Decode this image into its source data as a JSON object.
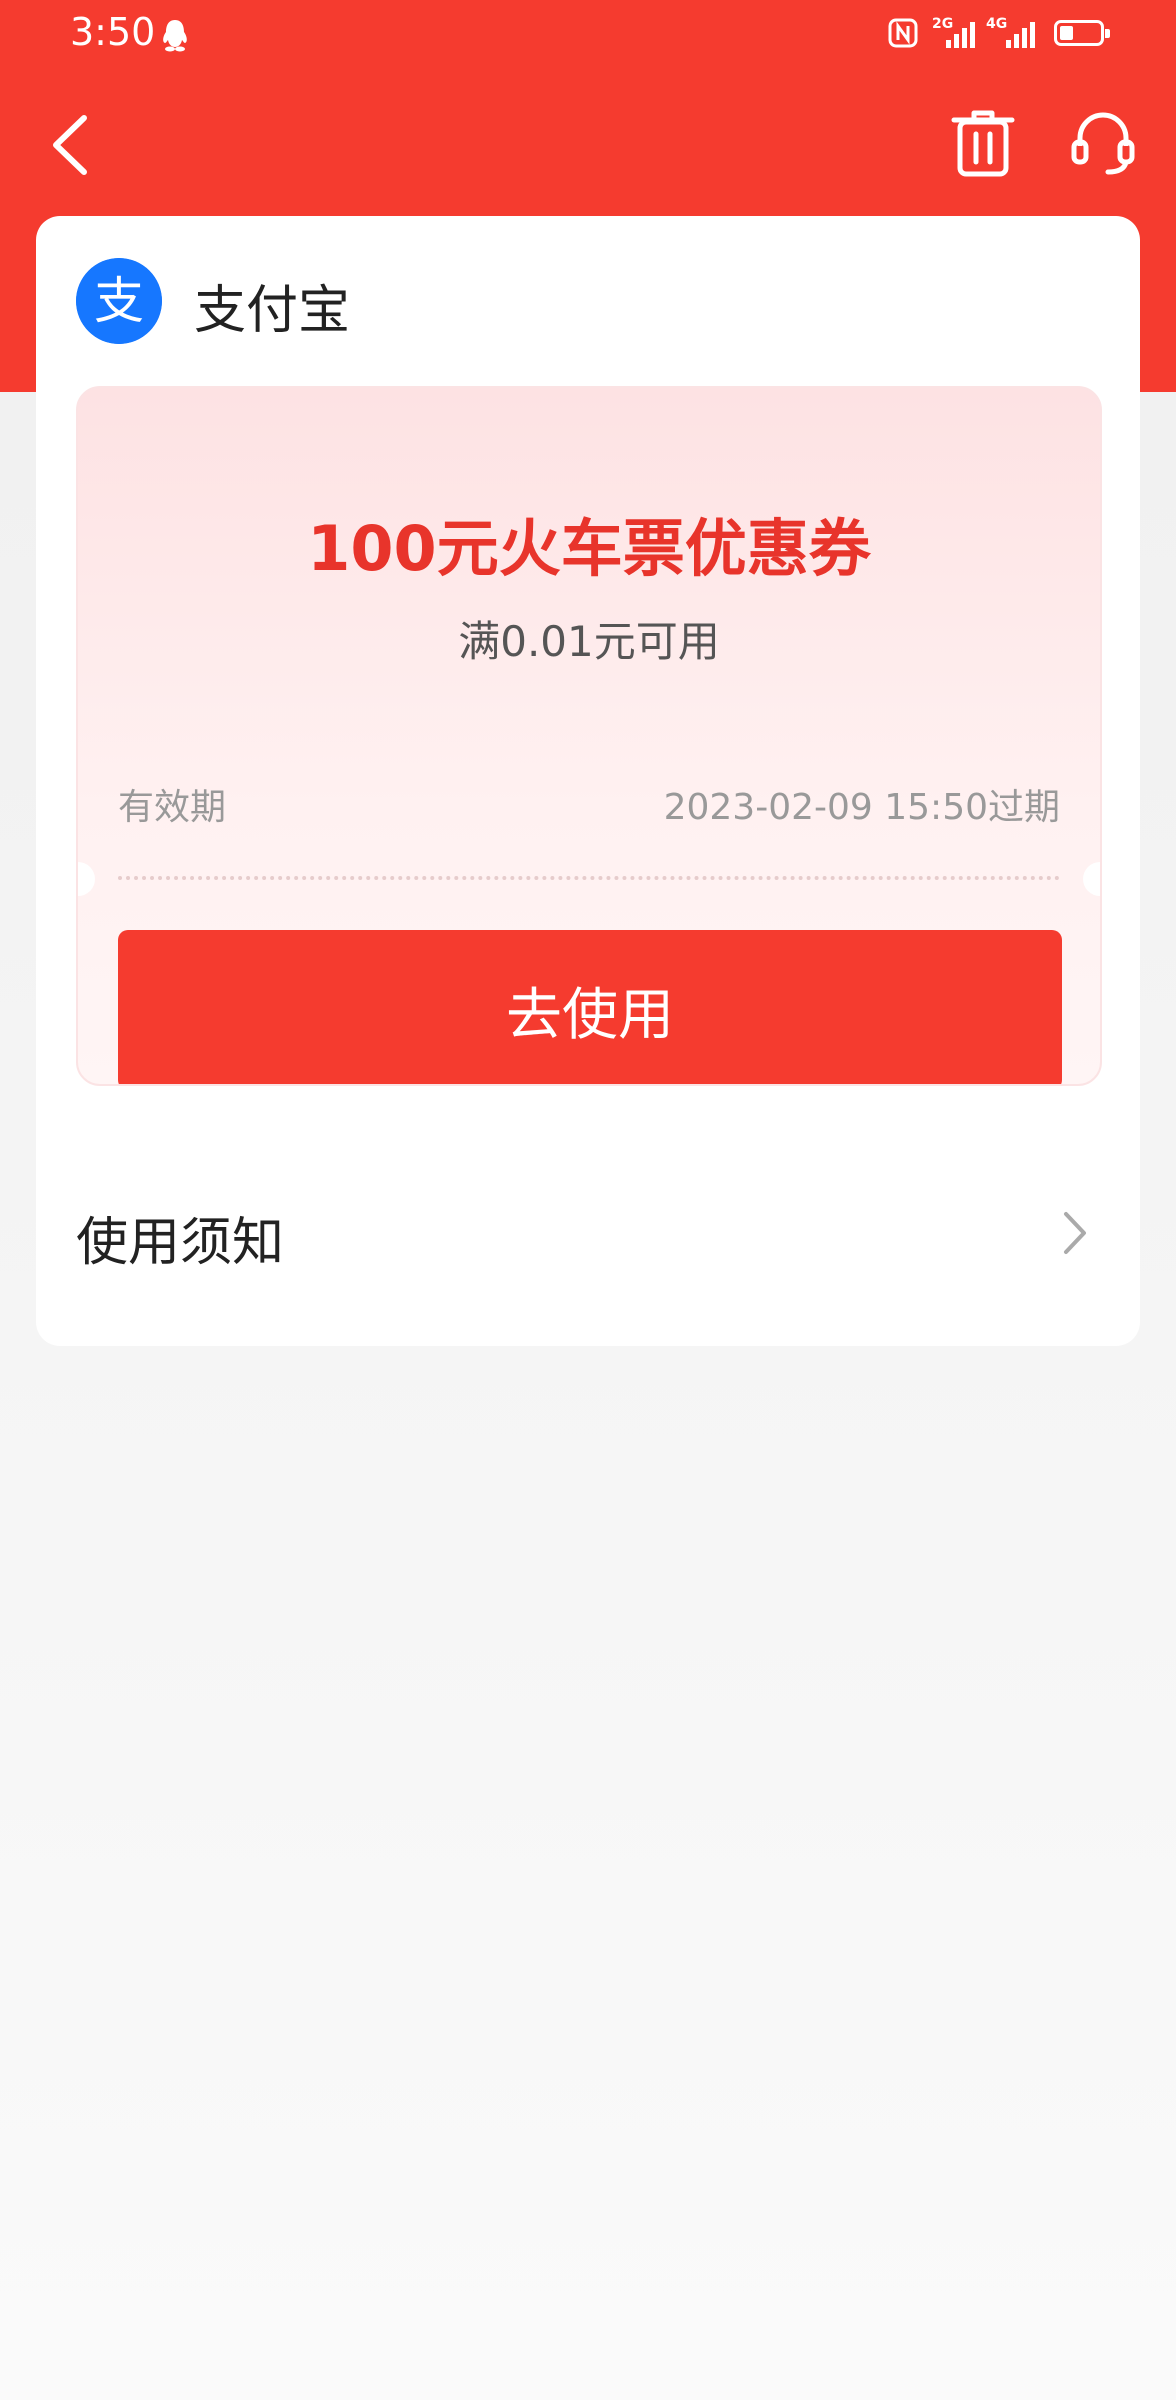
{
  "status_bar": {
    "time": "3:50",
    "network_1": "2G",
    "network_2": "4G",
    "battery_percent": 35
  },
  "nav": {
    "back_icon": "chevron-left-icon",
    "delete_icon": "trash-icon",
    "service_icon": "headset-icon"
  },
  "merchant": {
    "name": "支付宝",
    "logo_glyph": "支",
    "logo_color": "#1677ff"
  },
  "coupon": {
    "title": "100元火车票优惠券",
    "condition": "满0.01元可用",
    "validity_label": "有效期",
    "validity_value": "2023-02-09 15:50过期",
    "button_label": "去使用"
  },
  "notice": {
    "label": "使用须知"
  },
  "colors": {
    "accent": "#f53b2f",
    "title_red": "#e8342b"
  }
}
